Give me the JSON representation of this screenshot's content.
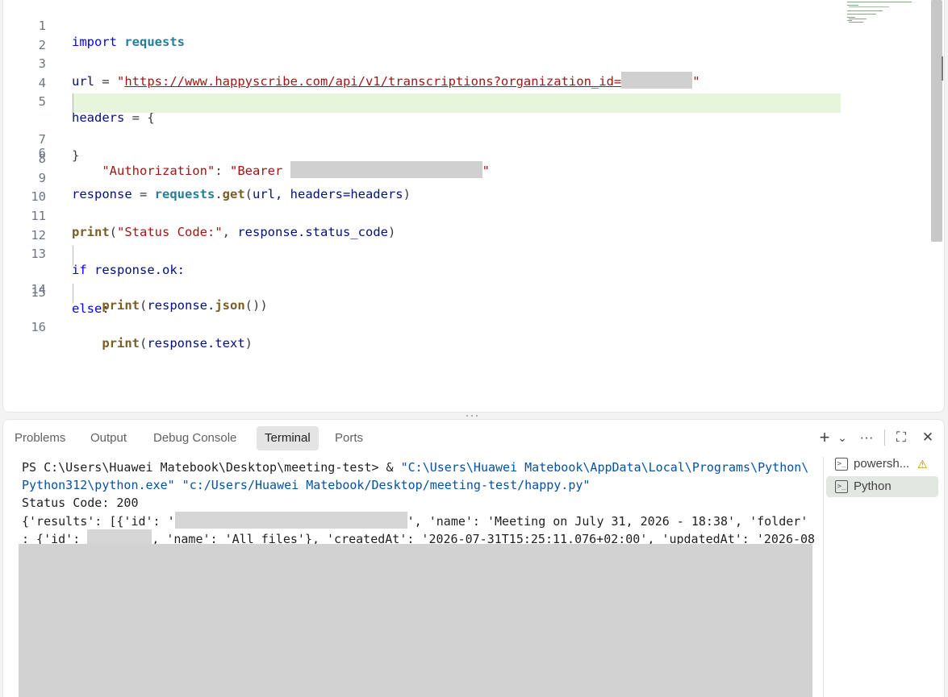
{
  "editor": {
    "line_numbers": [
      "1",
      "2",
      "3",
      "4",
      "5",
      "6",
      "7",
      "8",
      "9",
      "10",
      "11",
      "12",
      "13",
      "14",
      "15",
      "16"
    ],
    "code": {
      "l1_import": "import",
      "l1_module": "requests",
      "l3_var": "url",
      "l3_eq": " = ",
      "l3_quote_open": "\"",
      "l3_url": "https://www.happyscribe.com/api/v1/transcriptions?organization_id=",
      "l3_quote_close": "\"",
      "l5_var": "headers",
      "l5_rest": " = {",
      "l6_key": "\"Authorization\"",
      "l6_colon": ": ",
      "l6_value": "\"Bearer ",
      "l6_quote_close": "\"",
      "l7": "}",
      "l9_var": "response",
      "l9_eq": " = ",
      "l9_module": "requests",
      "l9_dot": ".",
      "l9_fn": "get",
      "l9_open": "(",
      "l9_args": "url, headers=headers",
      "l9_close": ")",
      "l11_fn": "print",
      "l11_open": "(",
      "l11_str": "\"Status Code:\"",
      "l11_mid": ", ",
      "l11_attr": "response.status_code",
      "l11_close": ")",
      "l13_kw": "if",
      "l13_rest": " response.ok:",
      "l14_fn": "print",
      "l14_open": "(",
      "l14_obj": "response.",
      "l14_method": "json",
      "l14_close": "())",
      "l15_kw": "else",
      "l15_colon": ":",
      "l16_fn": "print",
      "l16_open": "(",
      "l16_arg": "response.text",
      "l16_close": ")"
    }
  },
  "panel": {
    "tabs": [
      "Problems",
      "Output",
      "Debug Console",
      "Terminal",
      "Ports"
    ],
    "active_tab": "Terminal",
    "actions": {
      "new_terminal": "+",
      "dropdown": "⌄",
      "more": "···",
      "maximize": "⛶",
      "close": "✕"
    }
  },
  "terminal": {
    "prompt": "PS C:\\Users\\Huawei Matebook\\Desktop\\meeting-test> & ",
    "exe_line1": "\"C:\\Users\\Huawei Matebook\\AppData\\Local\\Programs\\Python\\",
    "exe_line2": "Python312\\python.exe\"",
    "script_path": " \"c:/Users/Huawei Matebook/Desktop/meeting-test/happy.py\"",
    "status": "Status Code: 200",
    "out1_a": "{'results': [{'id': '",
    "out1_b": "', 'name': 'Meeting on July 31, 2026 - 18:38', 'folder'",
    "out2_a": ": {'id': ",
    "out2_b": ", 'name': 'All files'}, 'createdAt': '2026-07-31T15:25:11.076+02:00', 'updatedAt': '2026-08"
  },
  "terminal_list": [
    {
      "name": "powersh...",
      "warning": "⚠"
    },
    {
      "name": "Python"
    }
  ],
  "colors": {
    "keyword": "#0000ff",
    "module": "#267f99",
    "function": "#795e26",
    "string": "#a31515",
    "terminal_string": "#0451a5",
    "highlight_line": "#e6f5dc"
  }
}
